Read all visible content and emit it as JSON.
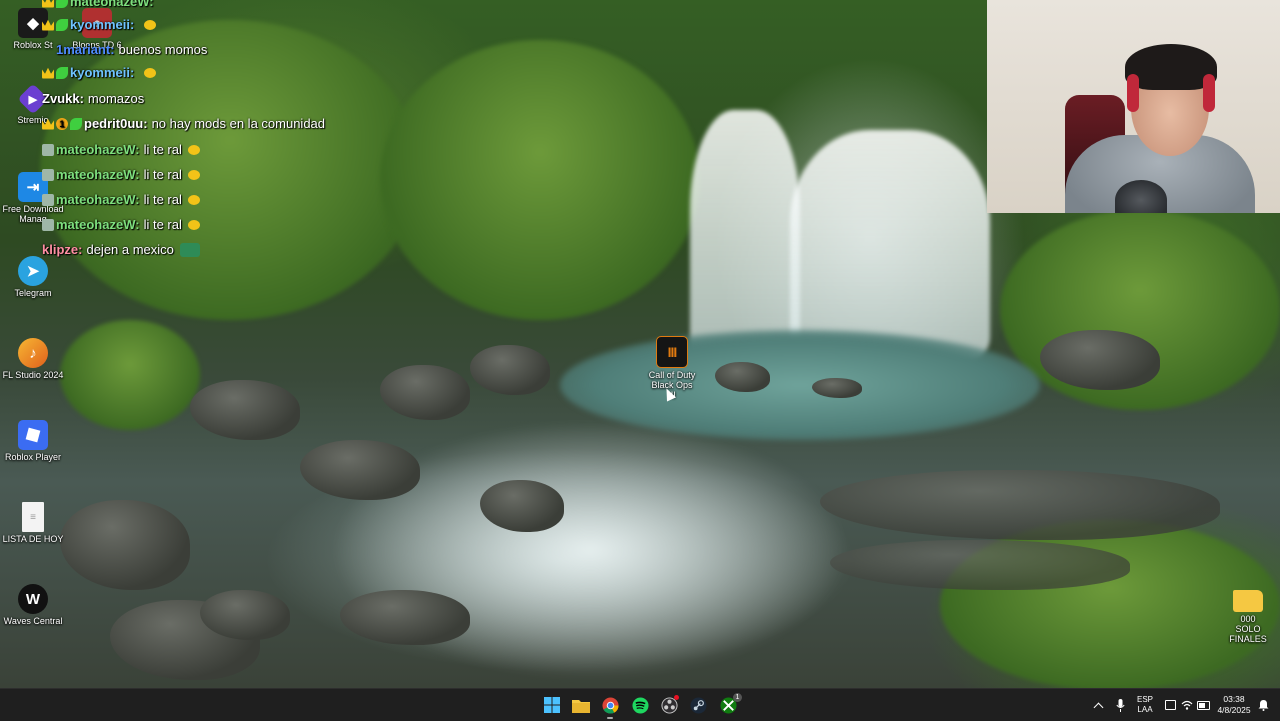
{
  "desktop": {
    "icons_left": [
      {
        "name": "roblox-studio",
        "label": "Roblox St",
        "icon": "roblox-studio-icon",
        "color": "#1a1a1a"
      },
      {
        "name": "bloons",
        "label": "Bloons TD 6",
        "icon": "bloons-icon",
        "color": "#b03030"
      },
      {
        "name": "stremio",
        "label": "Stremio",
        "icon": "stremio-icon",
        "color": "#6b3fd1"
      },
      {
        "name": "free-download-manager",
        "label": "Free Download Manag",
        "icon": "fdm-icon",
        "color": "#1e88e5"
      },
      {
        "name": "telegram",
        "label": "Telegram",
        "icon": "telegram-icon",
        "color": "#2aa3e0"
      },
      {
        "name": "fl-studio",
        "label": "FL Studio 2024",
        "icon": "fl-studio-icon",
        "color": "#f08a1c"
      },
      {
        "name": "roblox-player",
        "label": "Roblox Player",
        "icon": "roblox-player-icon",
        "color": "#3b6cf2"
      },
      {
        "name": "lista-de-hoy",
        "label": "LISTA DE HOY",
        "icon": "text-file-icon",
        "color": "#f3f3f3"
      },
      {
        "name": "waves-central",
        "label": "Waves Central",
        "icon": "waves-icon",
        "color": "#111111"
      }
    ],
    "center_icon": {
      "label": "Call of Duty Black Ops III",
      "icon": "call-of-duty-bo3-icon",
      "color": "#e07a10"
    },
    "right_icon": {
      "label": "000 SOLO FINALES",
      "icon": "folder-icon",
      "color": "#f5c842"
    }
  },
  "chat": {
    "lines": [
      {
        "badges": [
          "crown",
          "leaf"
        ],
        "user": "mateohazeW:",
        "user_color": "#7ee07e",
        "text": "",
        "emote": ""
      },
      {
        "badges": [
          "crown",
          "leaf"
        ],
        "user": "kyommeii:",
        "user_color": "#6fc3ff",
        "text": "",
        "emote": "yellow"
      },
      {
        "badges": [],
        "user": "1mariant:",
        "user_color": "#4f8cff",
        "text": "buenos momos",
        "emote": ""
      },
      {
        "badges": [
          "crown",
          "leaf"
        ],
        "user": "kyommeii:",
        "user_color": "#6fc3ff",
        "text": "",
        "emote": "yellow"
      },
      {
        "badges": [],
        "user": "Zvukk:",
        "user_color": "#ffffff",
        "text": "momazos",
        "emote": ""
      },
      {
        "badges": [
          "crown",
          "num",
          "leaf"
        ],
        "user": "pedrit0uu:",
        "user_color": "#ffffff",
        "text": "no hay mods en la comunidad",
        "emote": ""
      },
      {
        "badges": [
          "sword"
        ],
        "user": "mateohazeW:",
        "user_color": "#7ee07e",
        "text": "li te ral",
        "emote": "yellow"
      },
      {
        "badges": [
          "sword"
        ],
        "user": "mateohazeW:",
        "user_color": "#7ee07e",
        "text": "li te ral",
        "emote": "yellow"
      },
      {
        "badges": [
          "sword"
        ],
        "user": "mateohazeW:",
        "user_color": "#7ee07e",
        "text": "li te ral",
        "emote": "yellow"
      },
      {
        "badges": [
          "sword"
        ],
        "user": "mateohazeW:",
        "user_color": "#7ee07e",
        "text": "li te ral",
        "emote": "yellow"
      },
      {
        "badges": [],
        "user": "klipze:",
        "user_color": "#ff8fa3",
        "text": "dejen a mexico",
        "emote": "green"
      }
    ]
  },
  "taskbar": {
    "apps": [
      {
        "name": "start",
        "icon": "windows-start-icon"
      },
      {
        "name": "file-explorer",
        "icon": "folder-icon"
      },
      {
        "name": "chrome",
        "icon": "chrome-icon"
      },
      {
        "name": "spotify",
        "icon": "spotify-icon"
      },
      {
        "name": "obs",
        "icon": "obs-icon"
      },
      {
        "name": "steam",
        "icon": "steam-icon"
      },
      {
        "name": "xbox",
        "icon": "xbox-icon"
      }
    ],
    "tray": {
      "language_top": "ESP",
      "language_bottom": "LAA",
      "time": "03:38",
      "date": "4/8/2025"
    }
  },
  "colors": {
    "taskbar_bg": "#1f1f1f",
    "accent_blue": "#0078d4"
  }
}
